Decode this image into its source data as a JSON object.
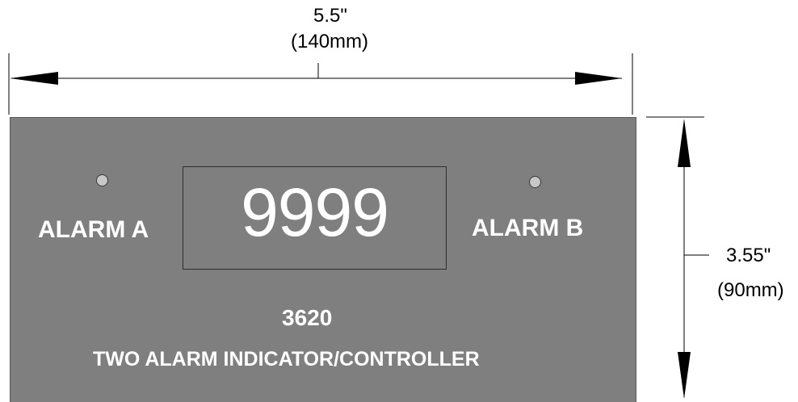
{
  "dimensions": {
    "width_inches": "5.5\"",
    "width_mm": "(140mm)",
    "height_inches": "3.55\"",
    "height_mm": "(90mm)"
  },
  "panel": {
    "color": "#7f7f7f",
    "alarm_a_label": "ALARM A",
    "alarm_b_label": "ALARM B",
    "display_value": "9999",
    "model_number": "3620",
    "description": "TWO ALARM INDICATOR/CONTROLLER"
  }
}
